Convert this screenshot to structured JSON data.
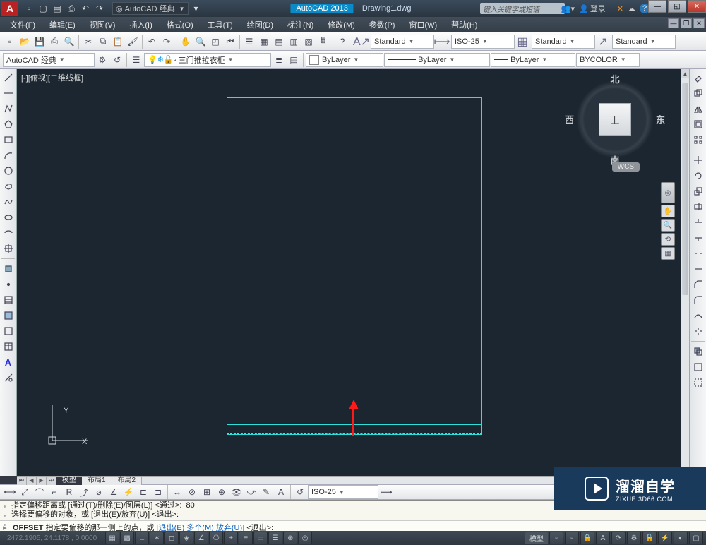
{
  "titlebar": {
    "app_letter": "A",
    "workspace_dd": "AutoCAD 经典",
    "app_name": "AutoCAD 2013",
    "doc_name": "Drawing1.dwg",
    "search_placeholder": "键入关键字或短语",
    "login": "登录",
    "qat": [
      "new",
      "open",
      "save",
      "undo",
      "redo",
      "plot"
    ],
    "help_btn": "?"
  },
  "menubar": {
    "items": [
      "文件(F)",
      "编辑(E)",
      "视图(V)",
      "插入(I)",
      "格式(O)",
      "工具(T)",
      "绘图(D)",
      "标注(N)",
      "修改(M)",
      "参数(P)",
      "窗口(W)",
      "帮助(H)"
    ]
  },
  "toolbar1": {
    "text_style": "Standard",
    "dim_style": "ISO-25",
    "table_style": "Standard",
    "ml_style": "Standard"
  },
  "toolbar2": {
    "workspace": "AutoCAD 经典",
    "drawing_label": "三门推拉衣柜",
    "layer_props": "ByLayer",
    "linetype": "ByLayer",
    "lineweight": "ByLayer",
    "plot_style": "BYCOLOR"
  },
  "viewport": {
    "label": "[-][俯视][二维线框]"
  },
  "viewcube": {
    "n": "北",
    "s": "南",
    "e": "东",
    "w": "西",
    "top": "上",
    "wcs": "WCS"
  },
  "ucs": {
    "x": "X",
    "y": "Y"
  },
  "tabs": {
    "model": "模型",
    "layout1": "布局1",
    "layout2": "布局2"
  },
  "dim_toolbar": {
    "style": "ISO-25"
  },
  "cmd": {
    "hist1_a": "指定偏移距离或 [通过(T)/删除(E)/图层(L)] <通过>:",
    "hist1_b": "80",
    "hist2": "选择要偏移的对象，或 [退出(E)/放弃(U)] <退出>:",
    "prompt_cmd": "OFFSET",
    "prompt_body": " 指定要偏移的那一侧上的点，或 ",
    "prompt_opts": "[退出(E) 多个(M) 放弃(U)]",
    "prompt_tail": " <退出>:"
  },
  "statusbar": {
    "coords": "2472.1905, 24.1178 , 0.0000",
    "model_lbl": "模型"
  },
  "watermark": {
    "cn": "溜溜自学",
    "en": "ZIXUE.3D66.COM"
  }
}
